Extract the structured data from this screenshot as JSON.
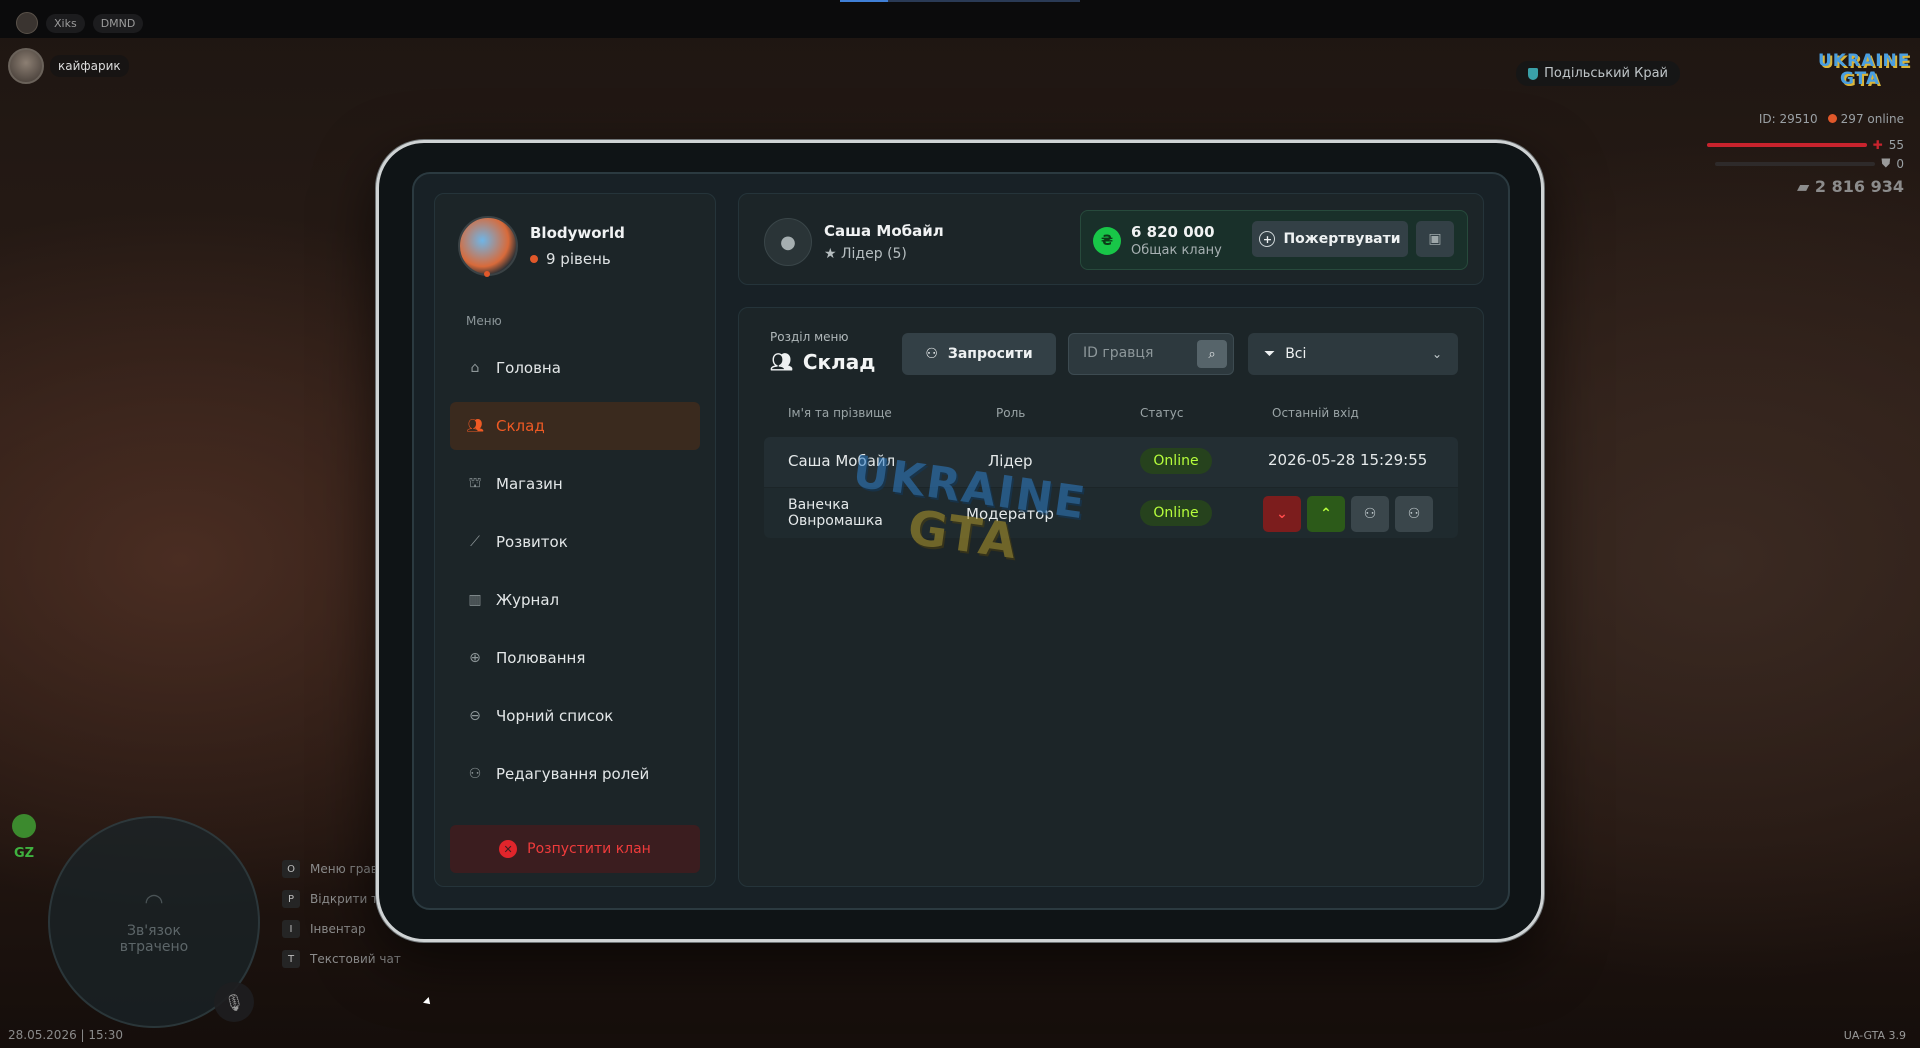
{
  "hud": {
    "topbar": {
      "player_tag": "Xiks",
      "server_tag": "DMND"
    },
    "player_name": "кайфарик",
    "server_name": "Подільський Край",
    "logo": {
      "line1": "UKRAINE",
      "line2": "GTA"
    },
    "id_text": "ID: 29510",
    "online_text": "297 online",
    "health": "55",
    "armor": "0",
    "money": "2 816 934",
    "gz_label": "GZ",
    "radar_text": "Зв'язок втрачено",
    "mic_key": "Я",
    "hints": [
      {
        "key": "O",
        "label": "Меню грав"
      },
      {
        "key": "P",
        "label": "Відкрити т"
      },
      {
        "key": "I",
        "label": "Інвентар"
      },
      {
        "key": "T",
        "label": "Текстовий чат"
      }
    ],
    "datetime": "28.05.2026 | 15:30",
    "version": "UA-GTA 3.9"
  },
  "clan": {
    "name": "Blodyworld",
    "level": "9 рівень"
  },
  "menu": {
    "label": "Меню",
    "items": [
      {
        "label": "Головна",
        "icon": "home-icon",
        "active": false
      },
      {
        "label": "Склад",
        "icon": "users-icon",
        "active": true
      },
      {
        "label": "Магазин",
        "icon": "basket-icon",
        "active": false
      },
      {
        "label": "Розвиток",
        "icon": "chart-icon",
        "active": false
      },
      {
        "label": "Журнал",
        "icon": "book-icon",
        "active": false
      },
      {
        "label": "Полювання",
        "icon": "crosshair-icon",
        "active": false
      },
      {
        "label": "Чорний список",
        "icon": "block-icon",
        "active": false
      },
      {
        "label": "Редагування ролей",
        "icon": "user-edit-icon",
        "active": false
      }
    ],
    "disband_label": "Розпустити клан"
  },
  "leader": {
    "name": "Саша Мобайл",
    "role": "Лідер (5)"
  },
  "bank": {
    "amount": "6 820 000",
    "label": "Общак клану",
    "currency_symbol": "₴",
    "donate_label": "Пожертвувати"
  },
  "section": {
    "label": "Розділ меню",
    "title": "Склад",
    "invite_label": "Запросити",
    "search_placeholder": "ID гравця",
    "filter_value": "Всі"
  },
  "table": {
    "headers": [
      "Ім'я та прізвище",
      "Роль",
      "Статус",
      "Останній вхід"
    ],
    "rows": [
      {
        "name": "Саша Мобайл",
        "role": "Лідер",
        "status": "Online",
        "last": "2026-05-28 15:29:55"
      },
      {
        "name": "Ванечка\nОвнромашка",
        "role": "Модератор",
        "status": "Online",
        "last": ""
      }
    ]
  },
  "watermark": {
    "line1": "UKRAINE",
    "line2": "GTA"
  },
  "colors": {
    "accent": "#ef5a24",
    "online": "#b7ff3c",
    "danger": "#e0252b",
    "coin": "#18c648"
  }
}
